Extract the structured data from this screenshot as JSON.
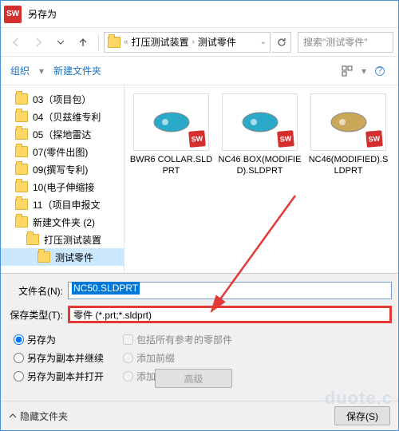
{
  "window": {
    "title": "另存为"
  },
  "nav": {
    "path_parts": [
      "打压测试装置",
      "测试零件"
    ],
    "search_placeholder": "搜索\"测试零件\""
  },
  "toolbar": {
    "organize": "组织",
    "new_folder": "新建文件夹"
  },
  "tree": {
    "items": [
      {
        "label": "03（项目包）",
        "indent": 1
      },
      {
        "label": "04（贝兹维专利",
        "indent": 1
      },
      {
        "label": "05（探地雷达",
        "indent": 1
      },
      {
        "label": "07(零件出图)",
        "indent": 1
      },
      {
        "label": "09(撰写专利)",
        "indent": 1
      },
      {
        "label": "10(电子伸缩接",
        "indent": 1
      },
      {
        "label": "11（项目申报文",
        "indent": 1
      },
      {
        "label": "新建文件夹 (2)",
        "indent": 1
      },
      {
        "label": "打压测试装置",
        "indent": 2
      },
      {
        "label": "测试零件",
        "indent": 3,
        "selected": true
      }
    ]
  },
  "files": [
    {
      "name": "BWR6 COLLAR.SLDPRT",
      "color": "#2aa9c9"
    },
    {
      "name": "NC46 BOX(MODIFIED).SLDPRT",
      "color": "#2aa9c9"
    },
    {
      "name": "NC46(MODIFIED).SLDPRT",
      "color": "#c9a85a"
    }
  ],
  "form": {
    "filename_label": "文件名(N):",
    "filename_value": "NC50.SLDPRT",
    "filetype_label": "保存类型(T):",
    "filetype_value": "零件 (*.prt;*.sldprt)"
  },
  "options": {
    "radios": [
      "另存为",
      "另存为副本并继续",
      "另存为副本并打开"
    ],
    "checks": [
      "包括所有参考的零部件",
      "添加前缀",
      "添加后缀"
    ],
    "advanced": "高级"
  },
  "footer": {
    "hide": "隐藏文件夹",
    "save": "保存(S)"
  },
  "watermark": "duote.c"
}
